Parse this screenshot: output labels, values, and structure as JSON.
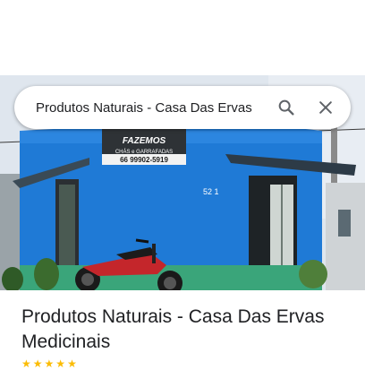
{
  "search": {
    "query": "Produtos Naturais - Casa Das Ervas",
    "search_icon": "search-icon",
    "clear_icon": "close-icon"
  },
  "photo": {
    "sign_line1": "FAZEMOS",
    "sign_line2": "CHÁS e GARRAFADAS",
    "sign_phone": "66 99902-5919",
    "house_number": "52 1"
  },
  "place": {
    "title": "Produtos Naturais - Casa Das Ervas Medicinais"
  },
  "colors": {
    "wall_blue": "#1f7ad6",
    "sky": "#dfe6ee",
    "rating_star": "#fbbc04"
  }
}
